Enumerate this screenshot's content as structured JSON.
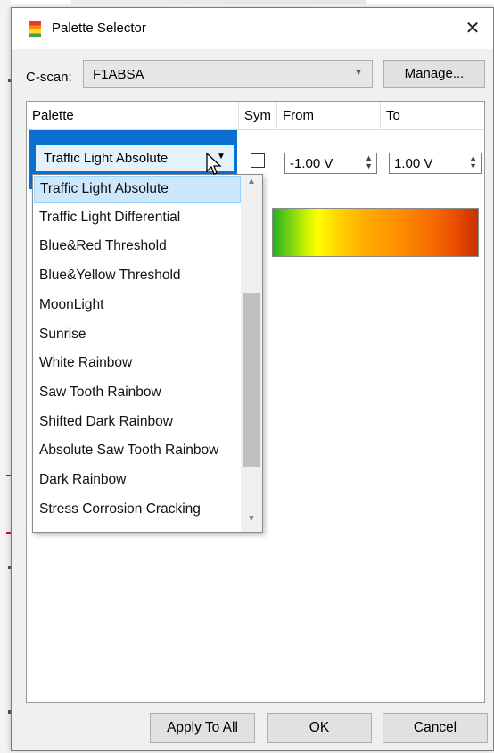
{
  "window": {
    "title": "Palette Selector",
    "close_glyph": "✕"
  },
  "cscan": {
    "label": "C-scan:",
    "value": "F1ABSA",
    "manage_label": "Manage..."
  },
  "table": {
    "headers": [
      "Palette",
      "Sym",
      "From",
      "To"
    ],
    "row": {
      "palette": "Traffic Light Absolute",
      "sym_checked": false,
      "from": "-1.00 V",
      "to": "1.00 V"
    }
  },
  "dropdown": {
    "selected_index": 0,
    "items": [
      "Traffic Light Absolute",
      "Traffic Light Differential",
      "Blue&Red Threshold",
      "Blue&Yellow Threshold",
      "MoonLight",
      "Sunrise",
      "White Rainbow",
      "Saw Tooth Rainbow",
      "Shifted Dark Rainbow",
      "Absolute Saw Tooth Rainbow",
      "Dark Rainbow",
      "Stress Corrosion Cracking"
    ]
  },
  "buttons": {
    "apply_all": "Apply To All",
    "ok": "OK",
    "cancel": "Cancel"
  },
  "icons": {
    "app": "palette-icon",
    "close": "close-icon",
    "combo_arrow": "chevron-down-icon",
    "spin": "spin-arrows-icon",
    "cursor": "mouse-pointer-icon"
  },
  "colors": {
    "selection_blue": "#0a6fd1",
    "list_highlight": "#cce8ff",
    "gradient_start": "#22b21f",
    "gradient_mid": "#ffff00",
    "gradient_end": "#c63400"
  }
}
